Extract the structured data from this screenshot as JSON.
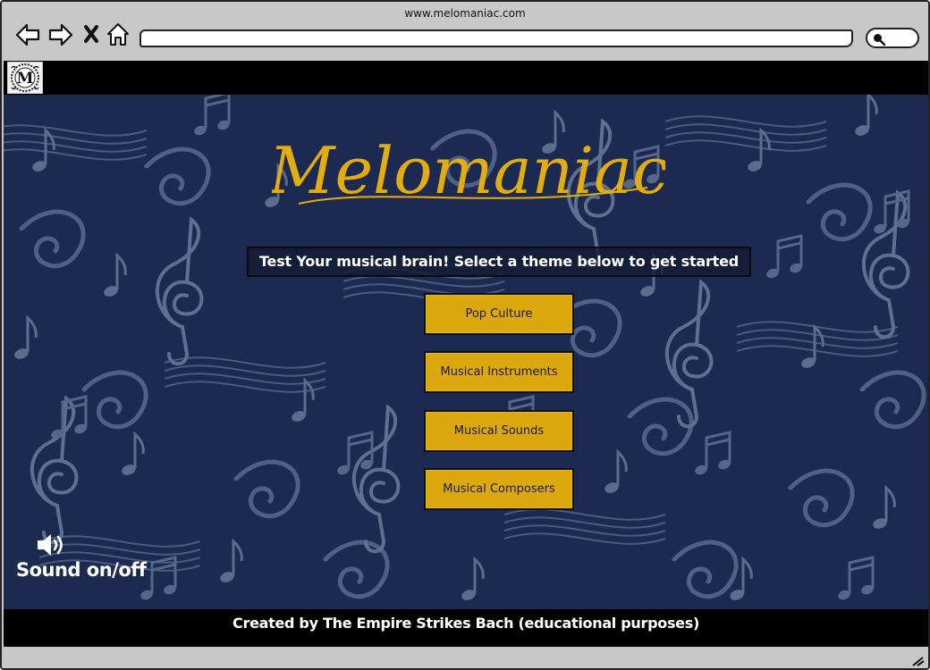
{
  "browser": {
    "url": "www.melomaniac.com",
    "icons": {
      "back": "back-arrow-icon",
      "forward": "forward-arrow-icon",
      "close": "close-icon",
      "home": "home-icon",
      "search": "search-icon"
    }
  },
  "header": {
    "logo_letter": "M"
  },
  "hero": {
    "title": "Melomaniac",
    "tagline": "Test Your musical brain! Select a theme below to get started",
    "themes": [
      {
        "label": "Pop Culture"
      },
      {
        "label": "Musical Instruments"
      },
      {
        "label": "Musical Sounds"
      },
      {
        "label": "Musical Composers"
      }
    ],
    "sound": {
      "label": "Sound on/off",
      "icon": "speaker-icon"
    }
  },
  "footer": {
    "text": "Created by The Empire Strikes Bach (educational purposes)"
  },
  "colors": {
    "background": "#1d2a50",
    "accent": "#dba80f",
    "title": "#e2ad14",
    "bars": "#000000"
  }
}
